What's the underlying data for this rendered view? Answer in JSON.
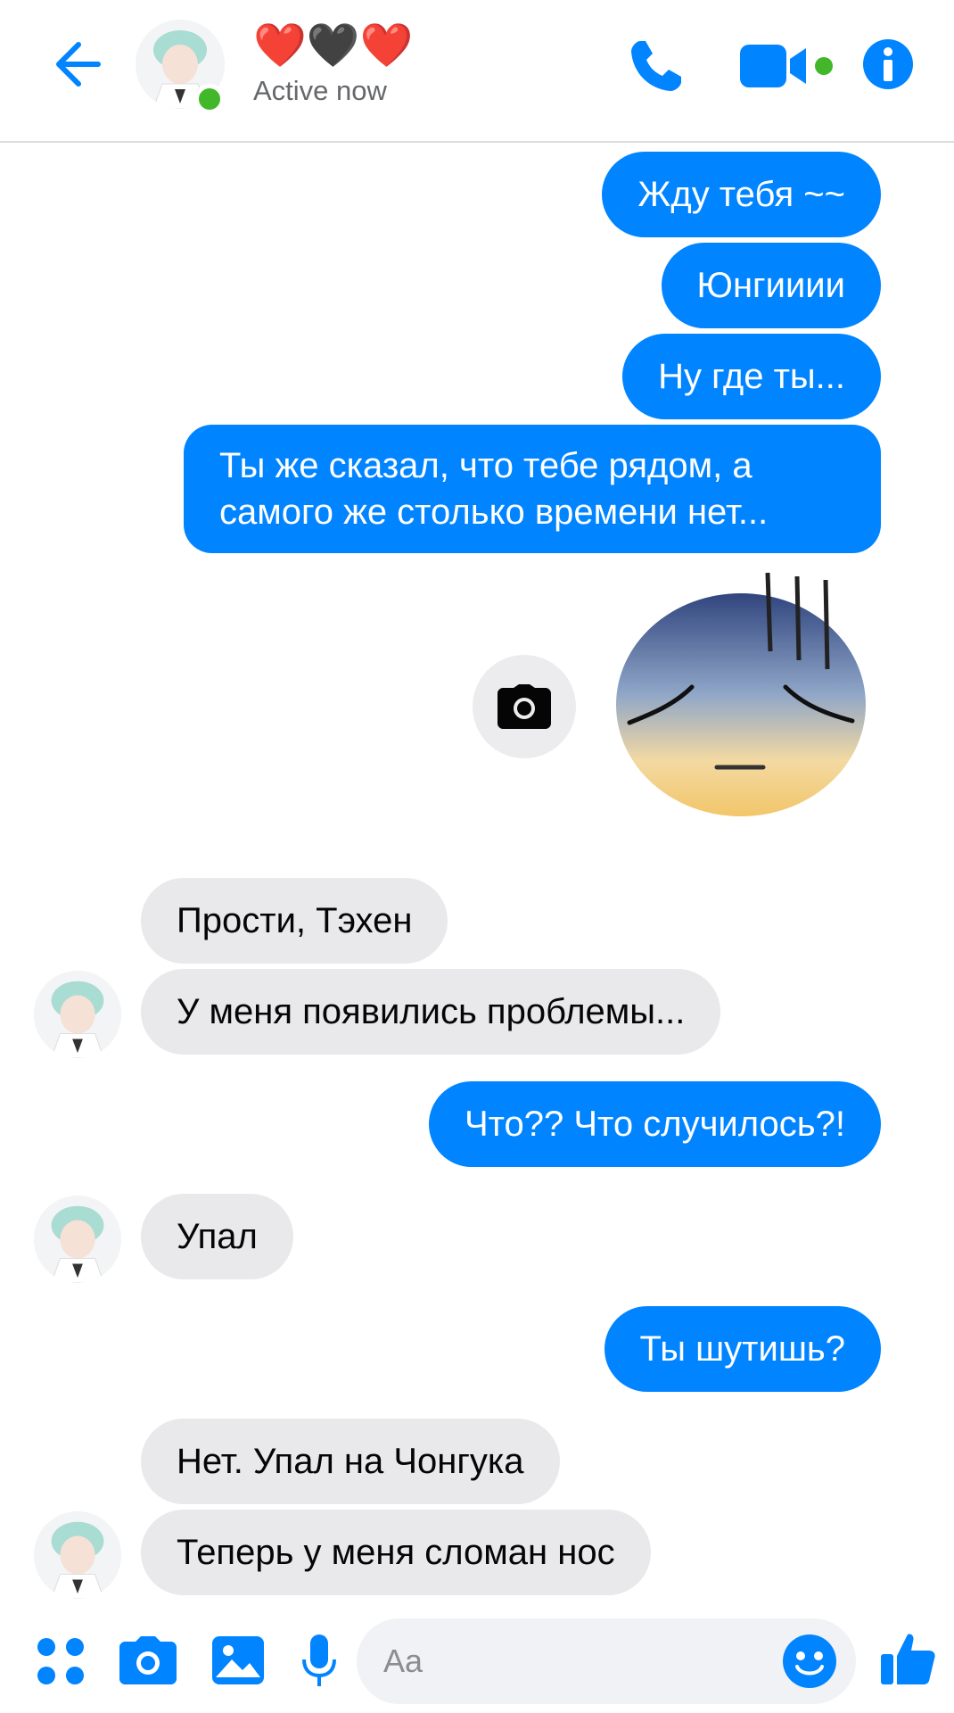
{
  "header": {
    "contact_name_emoji": "❤️🖤❤️",
    "status": "Active now"
  },
  "messages": [
    {
      "side": "out",
      "text": "Жду тебя ~~"
    },
    {
      "side": "out",
      "text": "Юнгииии"
    },
    {
      "side": "out",
      "text": "Ну где ты..."
    },
    {
      "side": "out",
      "text": "Ты же сказал, что тебе рядом, а самого же столько времени нет..."
    },
    {
      "side": "in",
      "text": "Прости, Тэхен"
    },
    {
      "side": "in",
      "text": "У меня появились проблемы..."
    },
    {
      "side": "out",
      "text": "Что?? Что случилось?!"
    },
    {
      "side": "in",
      "text": "Упал"
    },
    {
      "side": "out",
      "text": "Ты шутишь?"
    },
    {
      "side": "in",
      "text": "Нет. Упал на Чонгука"
    },
    {
      "side": "in",
      "text": "Теперь у меня сломан нос"
    }
  ],
  "composer": {
    "placeholder": "Aa"
  },
  "colors": {
    "accent": "#0084ff",
    "incoming_bubble": "#e9e9eb",
    "online": "#42b72a"
  },
  "icons": [
    "back-arrow-icon",
    "phone-icon",
    "video-camera-icon",
    "info-icon",
    "camera-icon",
    "apps-icon",
    "photo-icon",
    "microphone-icon",
    "emoji-icon",
    "thumbs-up-icon"
  ]
}
